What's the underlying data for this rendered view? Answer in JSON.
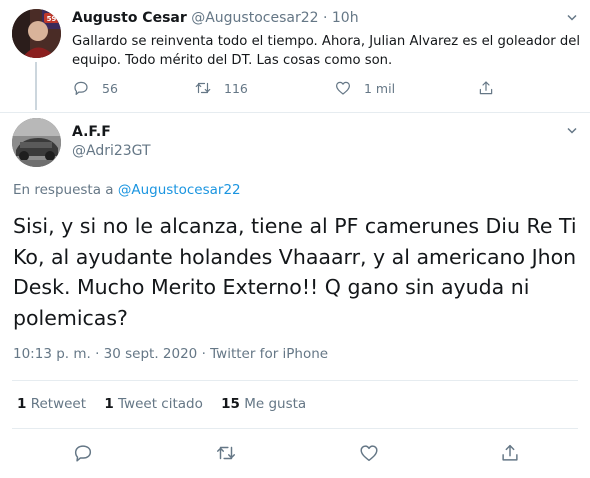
{
  "parent_tweet": {
    "author_name": "Augusto Cesar",
    "handle": "@Augustocesar22",
    "dot": "·",
    "time": "10h",
    "text": "Gallardo se reinventa todo el tiempo. Ahora, Julian Alvarez es el goleador del equipo. Todo mérito del DT. Las cosas como son.",
    "reply_count": "56",
    "retweet_count": "116",
    "like_count": "1 mil",
    "avatar_badge": "59"
  },
  "main_tweet": {
    "author_name": "A.F.F",
    "handle": "@Adri23GT",
    "reply_prefix": "En respuesta a ",
    "reply_to": "@Augustocesar22",
    "text": "Sisi, y si no le alcanza, tiene al PF  camerunes Diu Re Ti Ko, al ayudante holandes Vhaaarr, y al americano Jhon Desk. Mucho Merito Externo!! Q gano sin ayuda ni polemicas?",
    "timestamp": "10:13 p. m. · 30 sept. 2020 · Twitter for iPhone",
    "stats": [
      {
        "count": "1",
        "label": " Retweet"
      },
      {
        "count": "1",
        "label": " Tweet citado"
      },
      {
        "count": "15",
        "label": " Me gusta"
      }
    ]
  },
  "colors": {
    "link": "#1b95e0",
    "secondary_text": "#657786",
    "divider": "#e6ecf0"
  },
  "icons": [
    "reply-icon",
    "retweet-icon",
    "like-icon",
    "share-icon",
    "chevron-down-icon"
  ]
}
